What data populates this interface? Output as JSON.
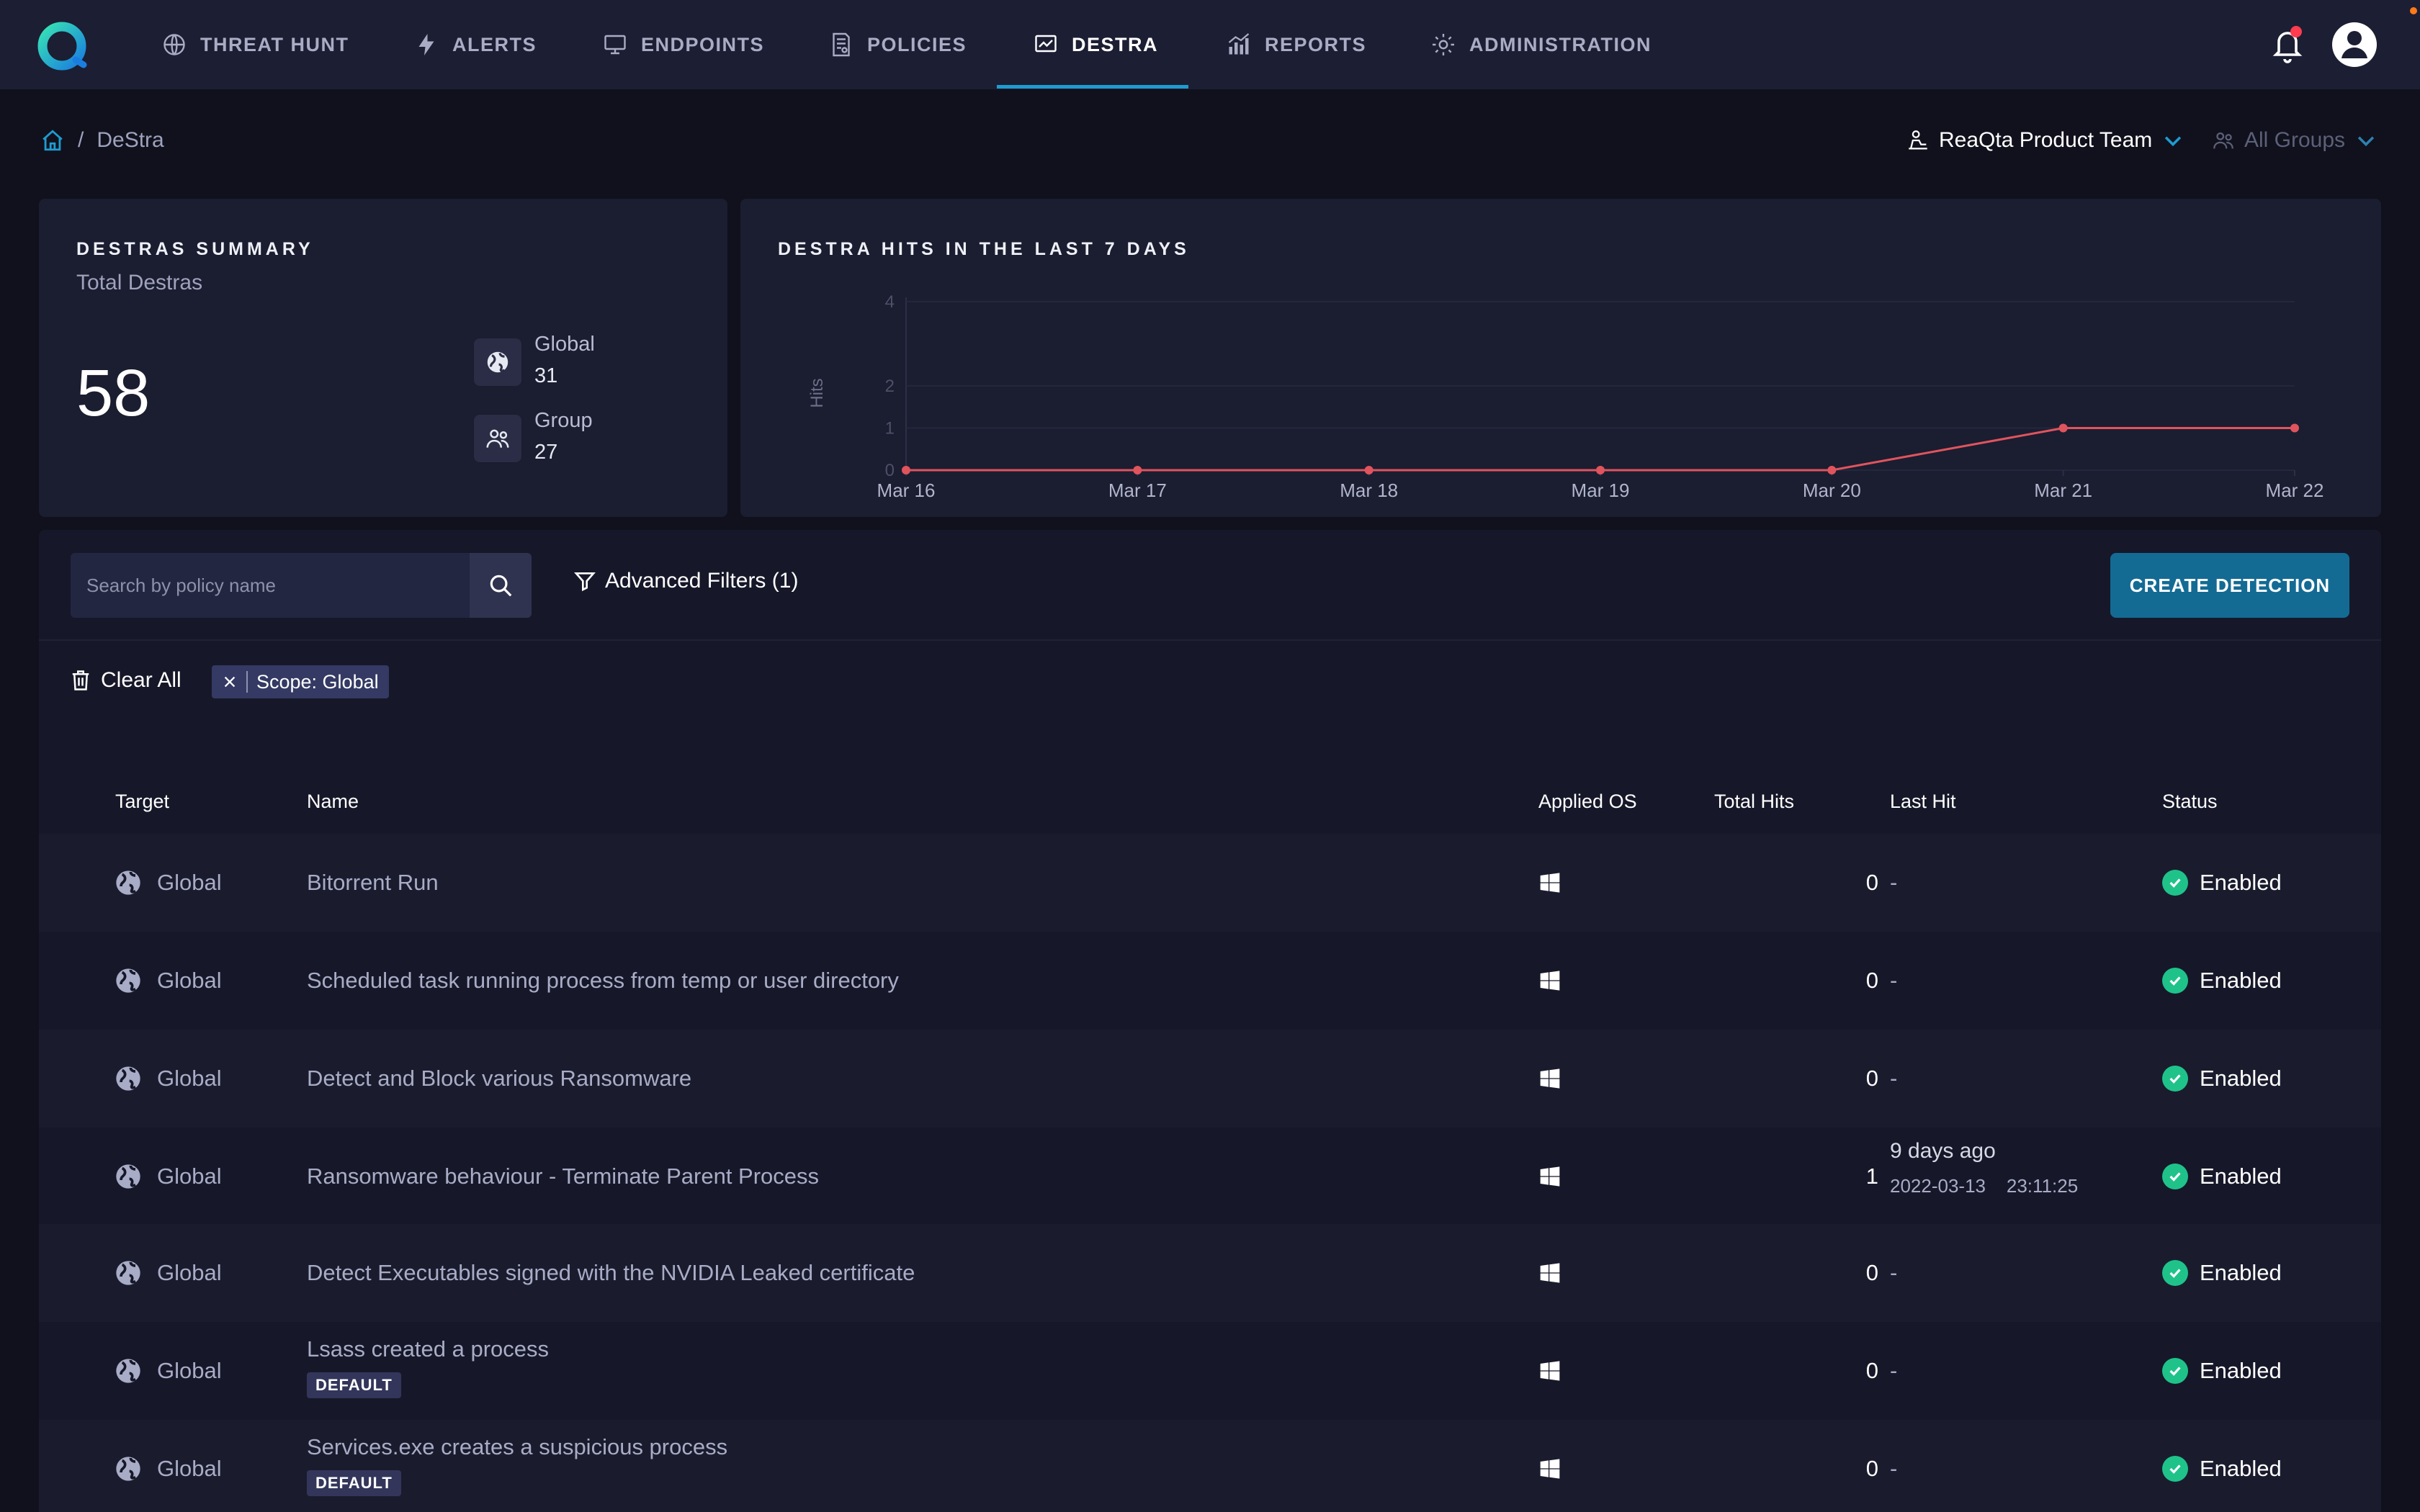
{
  "nav": {
    "items": [
      {
        "label": "THREAT HUNT",
        "icon": "globe-icon"
      },
      {
        "label": "ALERTS",
        "icon": "bolt-icon"
      },
      {
        "label": "ENDPOINTS",
        "icon": "monitor-icon"
      },
      {
        "label": "POLICIES",
        "icon": "policy-document-icon"
      },
      {
        "label": "DESTRA",
        "icon": "destra-monitor-icon"
      },
      {
        "label": "REPORTS",
        "icon": "bar-chart-icon"
      },
      {
        "label": "ADMINISTRATION",
        "icon": "gear-icon"
      }
    ],
    "active": "DESTRA"
  },
  "breadcrumb": {
    "current": "DeStra"
  },
  "filters_top": {
    "team": "ReaQta Product Team",
    "groups": "All Groups"
  },
  "summary": {
    "title": "DESTRAS SUMMARY",
    "subtitle": "Total Destras",
    "total": "58",
    "global_label": "Global",
    "global_value": "31",
    "group_label": "Group",
    "group_value": "27"
  },
  "hits_chart": {
    "title": "DESTRA HITS IN THE LAST 7 DAYS"
  },
  "chart_data": {
    "type": "line",
    "title": "DESTRA HITS IN THE LAST 7 DAYS",
    "xlabel": "",
    "ylabel": "Hits",
    "x": [
      "Mar 16",
      "Mar 17",
      "Mar 18",
      "Mar 19",
      "Mar 20",
      "Mar 21",
      "Mar 22"
    ],
    "series": [
      {
        "values": [
          0,
          0,
          0,
          0,
          0,
          1,
          1
        ]
      }
    ],
    "yticks": [
      "0",
      "1",
      "2",
      "4"
    ],
    "ylim": [
      0,
      4
    ],
    "color": "#e0545e",
    "grid": true
  },
  "toolbar": {
    "search_placeholder": "Search by policy name",
    "advanced_filters": "Advanced Filters (1)",
    "create_button": "CREATE DETECTION",
    "clear_all": "Clear All",
    "chip": "Scope: Global"
  },
  "table": {
    "headers": {
      "target": "Target",
      "name": "Name",
      "os": "Applied OS",
      "hits": "Total Hits",
      "last": "Last Hit",
      "status": "Status"
    },
    "rows": [
      {
        "target": "Global",
        "name": "Bitorrent Run",
        "hits": "0",
        "last": "-",
        "status": "Enabled"
      },
      {
        "target": "Global",
        "name": "Scheduled task running process from temp or user directory",
        "hits": "0",
        "last": "-",
        "status": "Enabled"
      },
      {
        "target": "Global",
        "name": "Detect and Block various Ransomware",
        "hits": "0",
        "last": "-",
        "status": "Enabled"
      },
      {
        "target": "Global",
        "name": "Ransomware behaviour - Terminate Parent Process",
        "hits": "1",
        "last": "9 days ago",
        "last_date": "2022-03-13    23:11:25",
        "status": "Enabled"
      },
      {
        "target": "Global",
        "name": "Detect Executables signed with the NVIDIA Leaked certificate",
        "hits": "0",
        "last": "-",
        "status": "Enabled"
      },
      {
        "target": "Global",
        "name": "Lsass created a process",
        "badge": "DEFAULT",
        "hits": "0",
        "last": "-",
        "status": "Enabled"
      },
      {
        "target": "Global",
        "name": "Services.exe creates a suspicious process",
        "badge": "DEFAULT",
        "hits": "0",
        "last": "-",
        "status": "Enabled"
      }
    ]
  },
  "colors": {
    "accent": "#1f9bd1",
    "enabled": "#1fc38a",
    "chart_line": "#e0545e",
    "notification": "#ff3b4f"
  }
}
